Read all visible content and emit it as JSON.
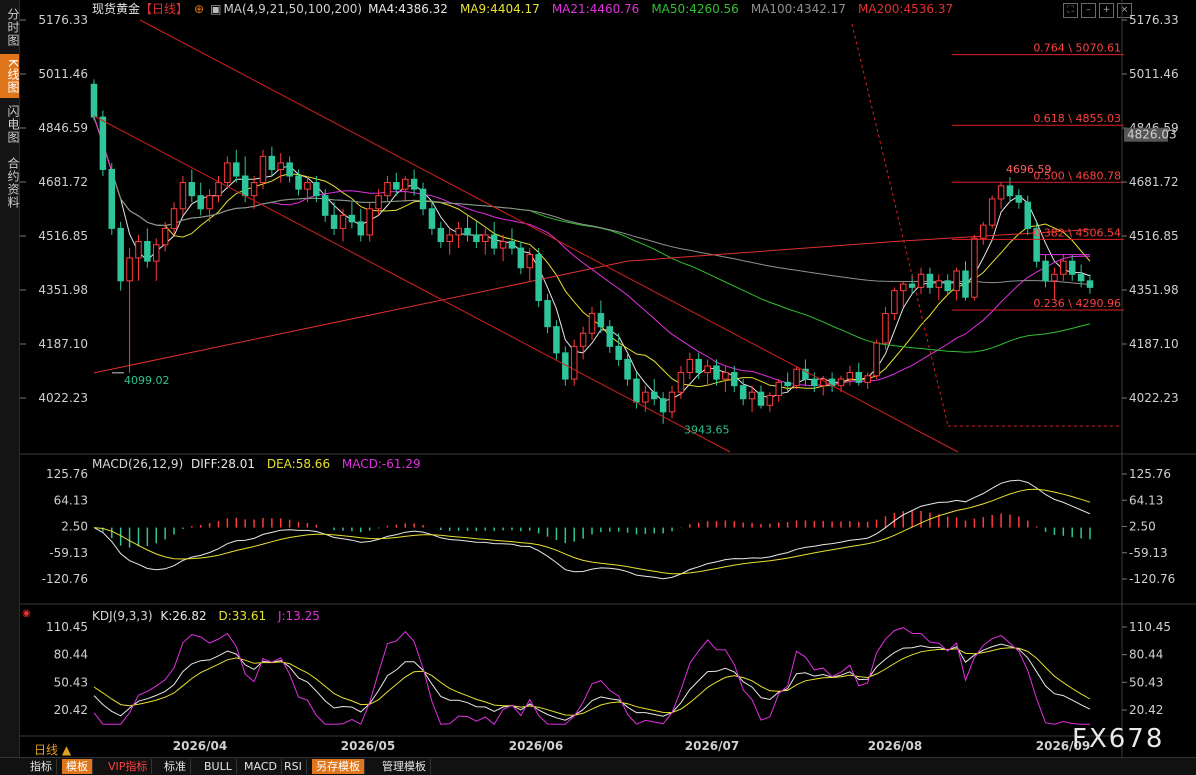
{
  "sidebar": {
    "items": [
      {
        "label": "分时图",
        "active": false
      },
      {
        "label": "K线图",
        "active": true
      },
      {
        "label": "闪电图",
        "active": false
      },
      {
        "label": "合约资料",
        "active": false
      }
    ]
  },
  "header": {
    "symbol": "现货黄金",
    "period": "【日线】",
    "ma_title": "MA(4,9,21,50,100,200)",
    "ma_values": [
      {
        "label": "MA4:4386.32",
        "color": "#e8e8e8"
      },
      {
        "label": "MA9:4404.17",
        "color": "#e8e030"
      },
      {
        "label": "MA21:4460.76",
        "color": "#e030e0"
      },
      {
        "label": "MA50:4260.56",
        "color": "#30c030"
      },
      {
        "label": "MA100:4342.17",
        "color": "#909090"
      },
      {
        "label": "MA200:4536.37",
        "color": "#e03030"
      }
    ]
  },
  "macd_header": {
    "title": "MACD(26,12,9)",
    "diff": "DIFF:28.01",
    "dea": "DEA:58.66",
    "macd": "MACD:-61.29"
  },
  "kdj_header": {
    "title": "KDJ(9,3,3)",
    "k": "K:26.82",
    "d": "D:33.61",
    "j": "J:13.25"
  },
  "price_axis": [
    "5176.33",
    "5011.46",
    "4846.59",
    "4681.72",
    "4516.85",
    "4351.98",
    "4187.10",
    "4022.23"
  ],
  "current_price": "4826.03",
  "macd_axis": [
    "125.76",
    "64.13",
    "2.50",
    "-59.13",
    "-120.76"
  ],
  "kdj_axis": [
    "110.45",
    "80.44",
    "50.43",
    "20.42"
  ],
  "x_axis_labels": [
    "2026/04",
    "2026/05",
    "2026/06",
    "2026/07",
    "2026/08",
    "2026/09"
  ],
  "annotations": {
    "low1": "4099.02",
    "low2": "3943.65",
    "high1": "4696.59"
  },
  "fib_levels": [
    {
      "label": "0.764 \\ 5070.61",
      "price": 5070.61
    },
    {
      "label": "0.618 \\ 4855.03",
      "price": 4855.03
    },
    {
      "label": "0.500 \\ 4680.78",
      "price": 4680.78
    },
    {
      "label": "0.382 \\ 4506.54",
      "price": 4506.54
    },
    {
      "label": "0.236 \\ 4290.96",
      "price": 4290.96
    }
  ],
  "bottom_tabs": [
    "指标",
    "模板",
    "VIP指标",
    "标准",
    "BULL",
    "MACD",
    "RSI",
    "另存模板",
    "管理模板"
  ],
  "period_label": "日线 ▲",
  "watermark": "FX678",
  "chart_data": {
    "type": "candlestick",
    "title": "现货黄金【日线】",
    "price_range": [
      3943.65,
      5176.33
    ],
    "note_ticks": [
      "5176.33",
      "5011.46",
      "4846.59",
      "4681.72",
      "4516.85",
      "4351.98",
      "4187.10",
      "4022.23"
    ],
    "key_points": {
      "low_april": 4099.02,
      "low_june": 3943.65,
      "high_august": 4696.59
    },
    "fibonacci": [
      {
        "ratio": 0.764,
        "price": 5070.61
      },
      {
        "ratio": 0.618,
        "price": 4855.03
      },
      {
        "ratio": 0.5,
        "price": 4680.78
      },
      {
        "ratio": 0.382,
        "price": 4506.54
      },
      {
        "ratio": 0.236,
        "price": 4290.96
      }
    ],
    "moving_averages": [
      {
        "name": "MA4",
        "value": 4386.32
      },
      {
        "name": "MA9",
        "value": 4404.17
      },
      {
        "name": "MA21",
        "value": 4460.76
      },
      {
        "name": "MA50",
        "value": 4260.56
      },
      {
        "name": "MA100",
        "value": 4342.17
      },
      {
        "name": "MA200",
        "value": 4536.37
      }
    ],
    "macd": {
      "diff": 28.01,
      "dea": 58.66,
      "macd": -61.29,
      "ylim": [
        -120.76,
        125.76
      ]
    },
    "kdj": {
      "k": 26.82,
      "d": 33.61,
      "j": 13.25,
      "ylim": [
        20.42,
        110.45
      ]
    },
    "candles": [
      [
        4980,
        4995,
        4870,
        4880
      ],
      [
        4880,
        4900,
        4700,
        4720
      ],
      [
        4720,
        4740,
        4520,
        4540
      ],
      [
        4540,
        4560,
        4350,
        4380
      ],
      [
        4380,
        4480,
        4099.02,
        4450
      ],
      [
        4450,
        4520,
        4380,
        4500
      ],
      [
        4500,
        4540,
        4420,
        4440
      ],
      [
        4440,
        4510,
        4380,
        4490
      ],
      [
        4490,
        4560,
        4470,
        4540
      ],
      [
        4540,
        4620,
        4520,
        4600
      ],
      [
        4600,
        4700,
        4580,
        4680
      ],
      [
        4680,
        4720,
        4620,
        4640
      ],
      [
        4640,
        4680,
        4580,
        4600
      ],
      [
        4600,
        4660,
        4560,
        4640
      ],
      [
        4640,
        4700,
        4620,
        4680
      ],
      [
        4680,
        4760,
        4660,
        4740
      ],
      [
        4740,
        4780,
        4680,
        4700
      ],
      [
        4700,
        4760,
        4620,
        4640
      ],
      [
        4640,
        4700,
        4600,
        4680
      ],
      [
        4680,
        4780,
        4660,
        4760
      ],
      [
        4760,
        4790,
        4700,
        4720
      ],
      [
        4720,
        4770,
        4680,
        4740
      ],
      [
        4740,
        4760,
        4680,
        4700
      ],
      [
        4700,
        4720,
        4640,
        4660
      ],
      [
        4660,
        4700,
        4620,
        4680
      ],
      [
        4680,
        4700,
        4620,
        4640
      ],
      [
        4640,
        4660,
        4560,
        4580
      ],
      [
        4580,
        4620,
        4520,
        4540
      ],
      [
        4540,
        4600,
        4500,
        4580
      ],
      [
        4580,
        4620,
        4540,
        4560
      ],
      [
        4560,
        4600,
        4500,
        4520
      ],
      [
        4520,
        4620,
        4500,
        4600
      ],
      [
        4600,
        4660,
        4580,
        4640
      ],
      [
        4640,
        4700,
        4620,
        4680
      ],
      [
        4680,
        4710,
        4640,
        4660
      ],
      [
        4660,
        4700,
        4620,
        4690
      ],
      [
        4690,
        4720,
        4640,
        4660
      ],
      [
        4660,
        4680,
        4580,
        4600
      ],
      [
        4600,
        4620,
        4520,
        4540
      ],
      [
        4540,
        4560,
        4480,
        4500
      ],
      [
        4500,
        4540,
        4460,
        4520
      ],
      [
        4520,
        4560,
        4480,
        4540
      ],
      [
        4540,
        4580,
        4500,
        4520
      ],
      [
        4520,
        4560,
        4480,
        4500
      ],
      [
        4500,
        4540,
        4460,
        4520
      ],
      [
        4520,
        4560,
        4460,
        4480
      ],
      [
        4480,
        4520,
        4440,
        4500
      ],
      [
        4500,
        4540,
        4460,
        4480
      ],
      [
        4480,
        4500,
        4400,
        4420
      ],
      [
        4420,
        4480,
        4380,
        4460
      ],
      [
        4460,
        4480,
        4300,
        4320
      ],
      [
        4320,
        4340,
        4220,
        4240
      ],
      [
        4240,
        4260,
        4140,
        4160
      ],
      [
        4160,
        4180,
        4060,
        4080
      ],
      [
        4080,
        4200,
        4060,
        4180
      ],
      [
        4180,
        4240,
        4140,
        4220
      ],
      [
        4220,
        4300,
        4200,
        4280
      ],
      [
        4280,
        4320,
        4220,
        4240
      ],
      [
        4240,
        4260,
        4160,
        4180
      ],
      [
        4180,
        4220,
        4120,
        4140
      ],
      [
        4140,
        4160,
        4060,
        4080
      ],
      [
        4080,
        4100,
        3990,
        4010
      ],
      [
        4010,
        4060,
        3980,
        4040
      ],
      [
        4040,
        4080,
        4000,
        4020
      ],
      [
        4020,
        4040,
        3943.65,
        3980
      ],
      [
        3980,
        4060,
        3960,
        4040
      ],
      [
        4040,
        4120,
        4020,
        4100
      ],
      [
        4100,
        4160,
        4080,
        4140
      ],
      [
        4140,
        4160,
        4080,
        4100
      ],
      [
        4100,
        4140,
        4060,
        4120
      ],
      [
        4120,
        4140,
        4060,
        4080
      ],
      [
        4080,
        4120,
        4040,
        4100
      ],
      [
        4100,
        4120,
        4040,
        4060
      ],
      [
        4060,
        4080,
        4000,
        4020
      ],
      [
        4020,
        4060,
        3980,
        4040
      ],
      [
        4040,
        4060,
        3990,
        4000
      ],
      [
        4000,
        4040,
        3980,
        4030
      ],
      [
        4030,
        4080,
        4010,
        4070
      ],
      [
        4070,
        4100,
        4040,
        4060
      ],
      [
        4060,
        4120,
        4050,
        4110
      ],
      [
        4110,
        4140,
        4060,
        4080
      ],
      [
        4080,
        4100,
        4040,
        4060
      ],
      [
        4060,
        4090,
        4030,
        4080
      ],
      [
        4080,
        4100,
        4040,
        4060
      ],
      [
        4060,
        4090,
        4040,
        4080
      ],
      [
        4080,
        4120,
        4060,
        4100
      ],
      [
        4100,
        4130,
        4060,
        4070
      ],
      [
        4070,
        4100,
        4050,
        4090
      ],
      [
        4090,
        4200,
        4080,
        4190
      ],
      [
        4190,
        4300,
        4170,
        4280
      ],
      [
        4280,
        4360,
        4260,
        4350
      ],
      [
        4350,
        4380,
        4300,
        4370
      ],
      [
        4370,
        4400,
        4340,
        4360
      ],
      [
        4360,
        4420,
        4340,
        4400
      ],
      [
        4400,
        4420,
        4340,
        4360
      ],
      [
        4360,
        4400,
        4320,
        4380
      ],
      [
        4380,
        4400,
        4340,
        4350
      ],
      [
        4350,
        4420,
        4320,
        4410
      ],
      [
        4410,
        4440,
        4320,
        4330
      ],
      [
        4330,
        4520,
        4320,
        4510
      ],
      [
        4510,
        4560,
        4490,
        4550
      ],
      [
        4550,
        4640,
        4540,
        4630
      ],
      [
        4630,
        4680,
        4600,
        4670
      ],
      [
        4670,
        4696.59,
        4620,
        4640
      ],
      [
        4640,
        4660,
        4600,
        4620
      ],
      [
        4620,
        4640,
        4520,
        4540
      ],
      [
        4540,
        4560,
        4420,
        4440
      ],
      [
        4440,
        4460,
        4360,
        4380
      ],
      [
        4380,
        4420,
        4320,
        4400
      ],
      [
        4400,
        4460,
        4380,
        4440
      ],
      [
        4440,
        4460,
        4380,
        4400
      ],
      [
        4400,
        4430,
        4360,
        4380
      ],
      [
        4380,
        4400,
        4340,
        4360
      ]
    ]
  }
}
